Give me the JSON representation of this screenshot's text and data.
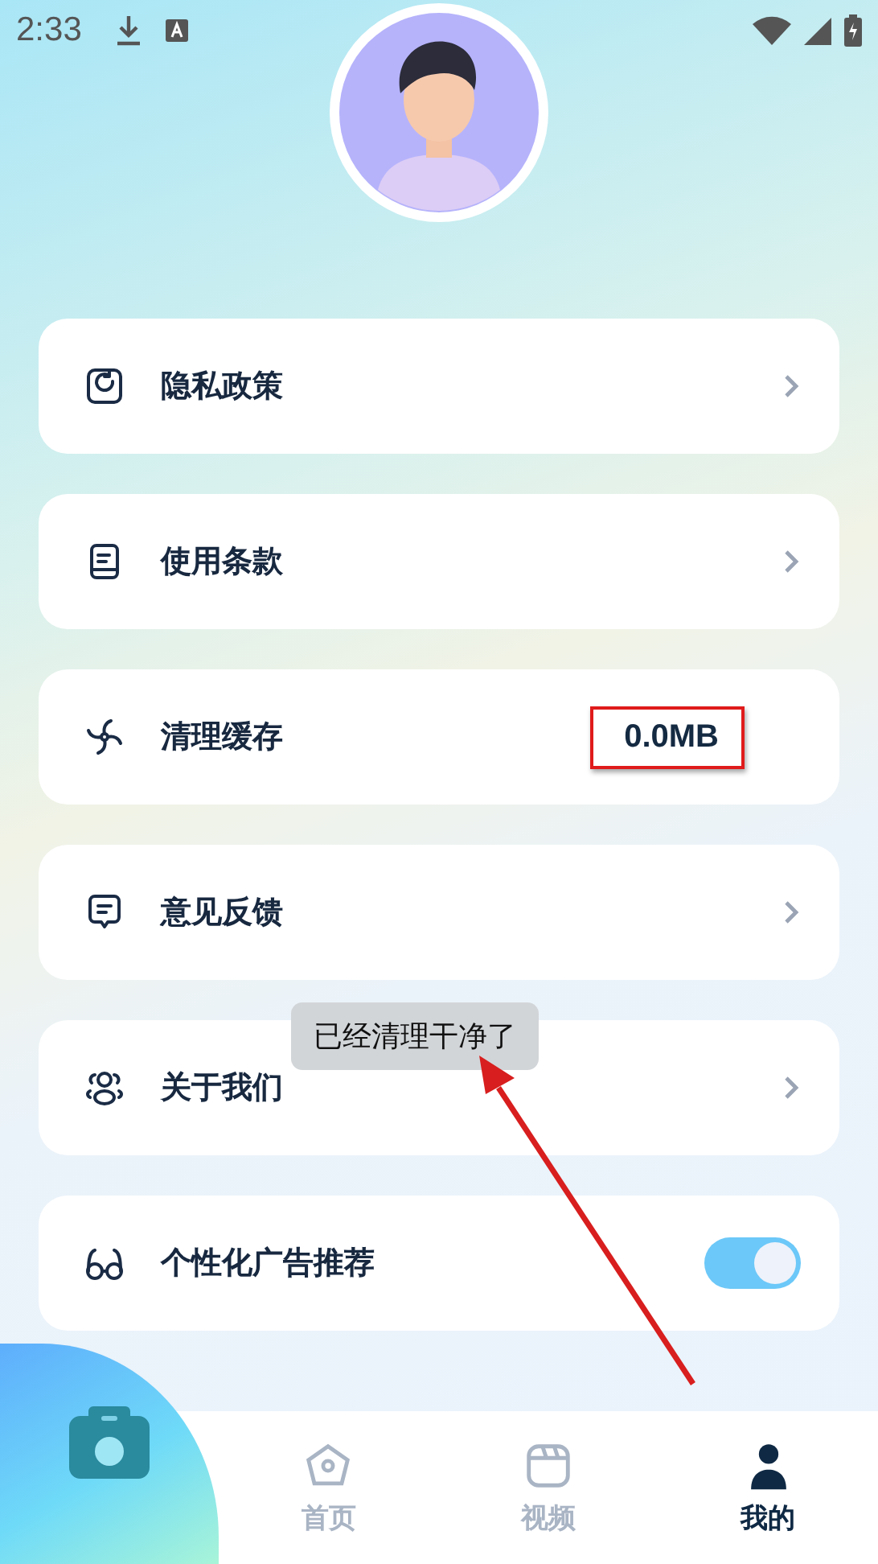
{
  "status_bar": {
    "time": "2:33"
  },
  "menu": [
    {
      "kind": "link",
      "label": "隐私政策"
    },
    {
      "kind": "link",
      "label": "使用条款"
    },
    {
      "kind": "value",
      "label": "清理缓存",
      "value": "0.0MB",
      "highlighted": true
    },
    {
      "kind": "link",
      "label": "意见反馈"
    },
    {
      "kind": "link",
      "label": "关于我们"
    },
    {
      "kind": "toggle",
      "label": "个性化广告推荐",
      "on": true
    }
  ],
  "toast": "已经清理干净了",
  "tabs": [
    {
      "label": "首页",
      "selected": false
    },
    {
      "label": "视频",
      "selected": false
    },
    {
      "label": "我的",
      "selected": true
    }
  ],
  "annotation_arrow": true
}
